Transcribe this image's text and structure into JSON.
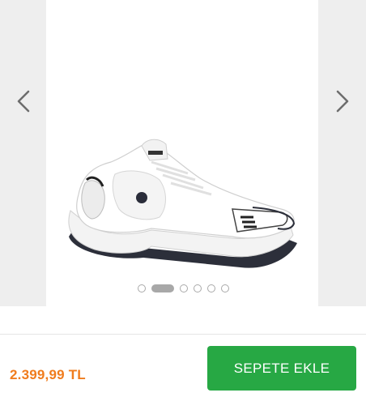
{
  "gallery": {
    "image": "white-sneaker-product-photo",
    "prev_icon": "chevron-left-icon",
    "next_icon": "chevron-right-icon",
    "dots_total": 6,
    "active_index": 1
  },
  "product": {
    "price": "2.399,99 TL",
    "add_to_cart_label": "SEPETE EKLE"
  },
  "colors": {
    "price": "#f07c1d",
    "button": "#27a844"
  }
}
